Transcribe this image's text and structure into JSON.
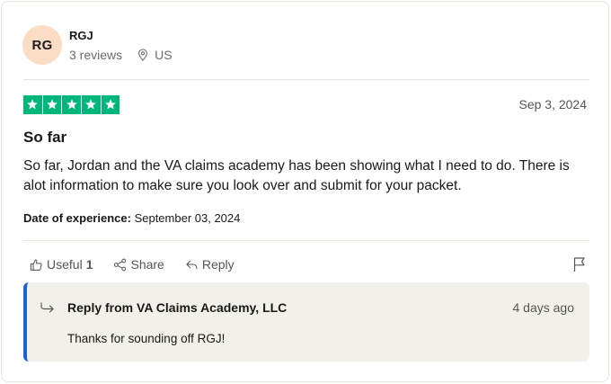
{
  "reviewer": {
    "initials": "RG",
    "name": "RGJ",
    "reviews": "3 reviews",
    "country": "US",
    "avatar_color": "#fbdcc5"
  },
  "review": {
    "rating": 5,
    "star_color": "#00b67a",
    "date": "Sep 3, 2024",
    "title": "So far",
    "body": "So far, Jordan and the VA claims academy has been showing what I need to do. There is alot information to make sure you look over and submit for your packet.",
    "experience_label": "Date of experience:",
    "experience_date": "September 03, 2024"
  },
  "actions": {
    "useful_label": "Useful",
    "useful_count": "1",
    "share_label": "Share",
    "reply_label": "Reply"
  },
  "company_reply": {
    "from": "Reply from VA Claims Academy, LLC",
    "date": "4 days ago",
    "text": "Thanks for sounding off RGJ!",
    "accent_color": "#1d5fd6"
  }
}
